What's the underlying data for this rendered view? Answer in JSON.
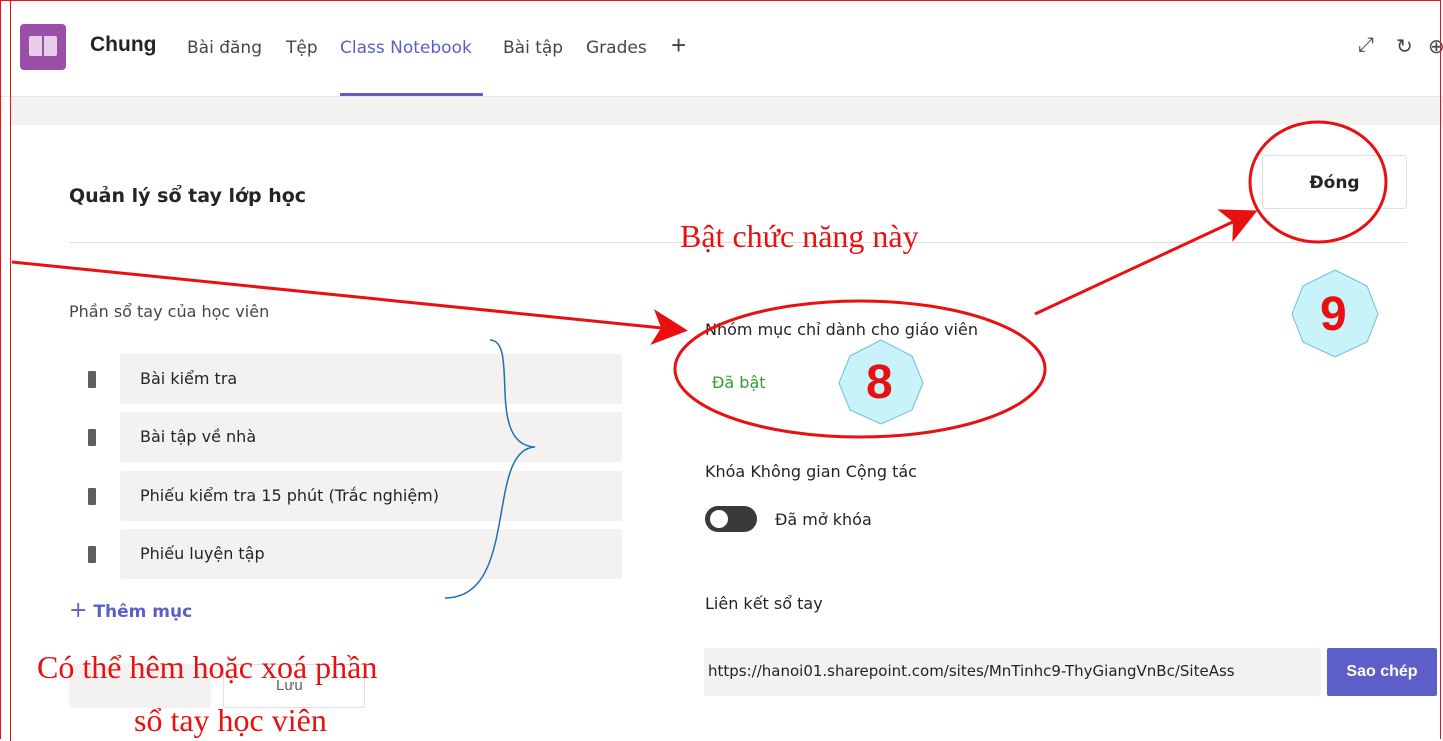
{
  "header": {
    "channel": "Chung",
    "tabs": [
      "Bài đăng",
      "Tệp",
      "Class Notebook",
      "Bài tập",
      "Grades"
    ],
    "active_tab": "Class Notebook",
    "add_tab": "+",
    "icons": [
      "expand-icon",
      "refresh-icon",
      "globe-icon"
    ]
  },
  "panel": {
    "title": "Quản lý sổ tay lớp học",
    "close_label": "Đóng"
  },
  "sections": {
    "label": "Phần sổ tay của học viên",
    "items": [
      "Bài kiểm tra",
      "Bài tập về nhà",
      "Phiếu kiểm tra 15 phút (Trắc nghiệm)",
      "Phiếu luyện tập"
    ],
    "add_label": "Thêm mục",
    "hidden_button": "Lưu"
  },
  "settings": {
    "teacher_only_label": "Nhóm mục chỉ dành cho giáo viên",
    "teacher_only_status": "Đã bật",
    "lock_label": "Khóa Không gian Cộng tác",
    "lock_status": "Đã mở khóa",
    "link_label": "Liên kết sổ tay",
    "link_value": "https://hanoi01.sharepoint.com/sites/MnTinhc9-ThyGiangVnBc/SiteAss",
    "copy_label": "Sao chép"
  },
  "annotations": {
    "enable_note": "Bật chức năng này",
    "sections_note_line1": "Có thể hêm hoặc xoá phần",
    "sections_note_line2": "sổ tay học viên",
    "badge_8": "8",
    "badge_9": "9"
  },
  "colors": {
    "accent": "#5b5fc7",
    "annotation": "#e81010",
    "badge_fill": "#c9f3fb",
    "enabled": "#2f9e2f"
  }
}
